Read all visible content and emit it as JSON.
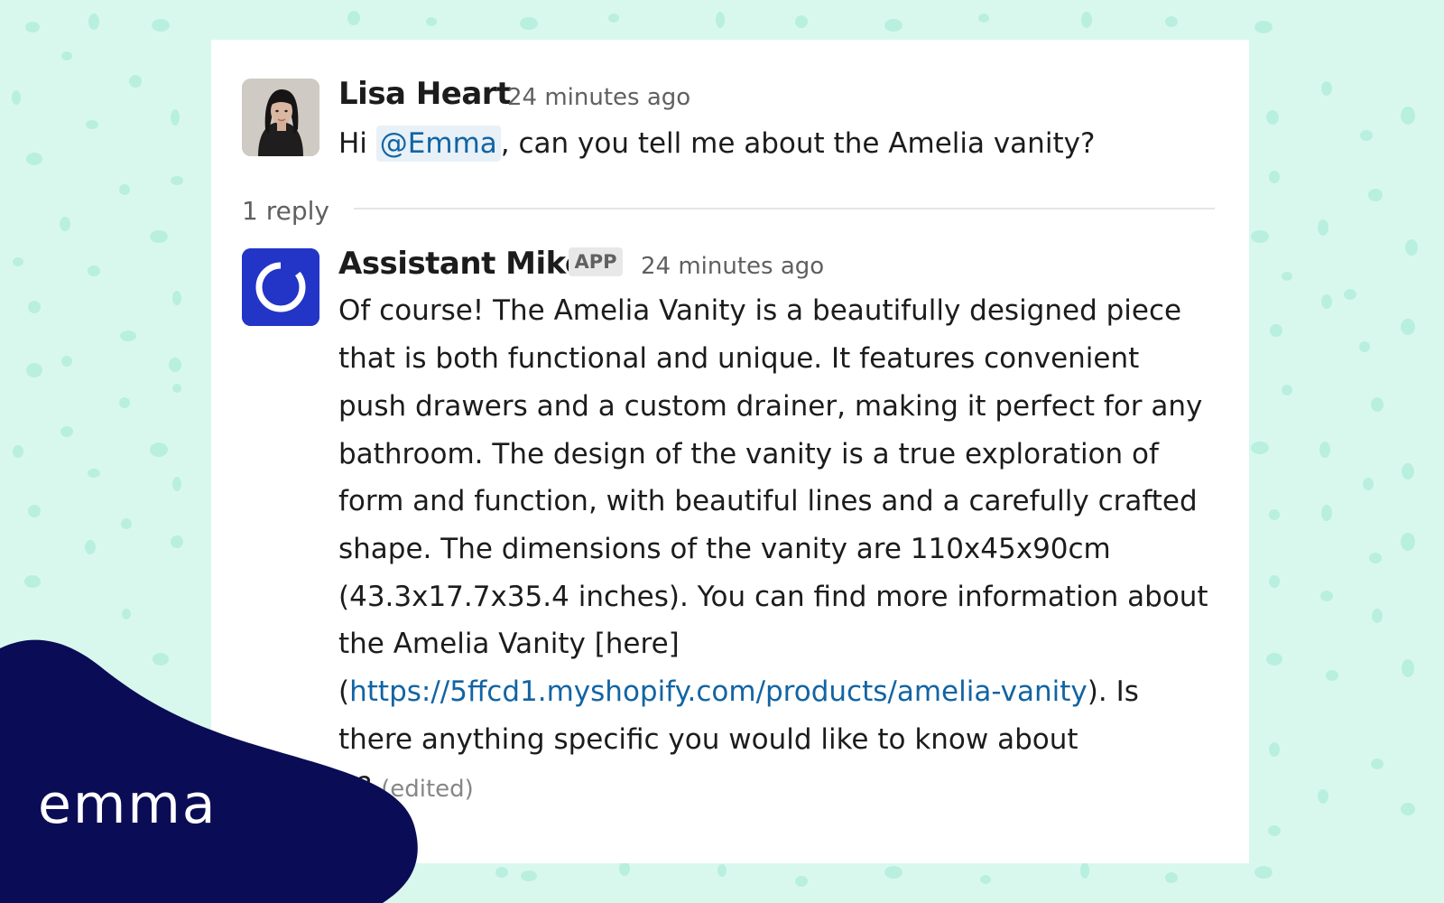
{
  "colors": {
    "background": "#d8f8ee",
    "card": "#ffffff",
    "mention": "#1264a3",
    "link": "#1264a3",
    "brand_blob": "#0a0c55",
    "bot_avatar": "#2235c6"
  },
  "thread": {
    "messages": [
      {
        "author": "Lisa Heart",
        "timestamp": "24 minutes ago",
        "avatar_icon": "user-photo-avatar",
        "text_prefix": "Hi ",
        "mention": "@Emma",
        "text_suffix": ", can you tell me about the Amelia vanity?"
      },
      {
        "author": "Assistant Mike",
        "badge": "APP",
        "timestamp": "24 minutes ago",
        "avatar_icon": "ring-logo-avatar",
        "lines": [
          "Of course! The Amelia Vanity is a beautifully designed piece",
          "that is both functional and unique. It features convenient",
          "push drawers and a custom drainer, making it perfect for any",
          "bathroom. The design of the vanity is a true exploration of",
          "form and function, with beautiful lines and a carefully crafted",
          "shape. The dimensions of the vanity are 110x45x90cm",
          "(43.3x17.7x35.4 inches). You can find more information about",
          "the Amelia Vanity [here]"
        ],
        "link_open": "(",
        "link": "https://5ffcd1.myshopify.com/products/amelia-vanity",
        "link_close": "). Is",
        "line_after_link": "there anything specific you would like to know about",
        "last_line": "it?",
        "edited_label": "(edited)"
      }
    ],
    "reply_count": "1 reply"
  },
  "branding": {
    "logo_text": "emma"
  }
}
